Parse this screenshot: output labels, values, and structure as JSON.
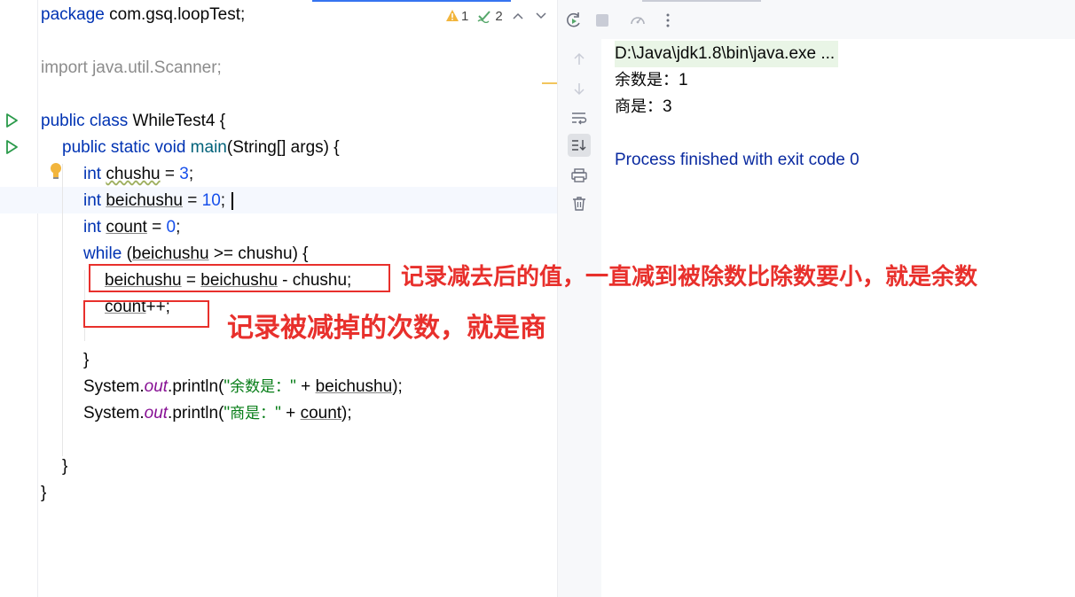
{
  "editor": {
    "package_kw": "package",
    "package_name": " com.gsq.loopTest;",
    "import_line": "import java.util.Scanner;",
    "class_decl": {
      "kw": "public class",
      "name": " WhileTest4 {"
    },
    "main_decl": {
      "kw1": "public static void",
      "fn": " main",
      "rest": "(String[] args) {"
    },
    "line_chushu": {
      "kw": "int",
      "var": "chushu",
      "eq": " = ",
      "val": "3",
      "end": ";"
    },
    "line_beichushu": {
      "kw": "int",
      "var": "beichushu",
      "eq": " = ",
      "val": "10",
      "end": ";"
    },
    "line_count": {
      "kw": "int",
      "var": "count",
      "eq": " = ",
      "val": "0",
      "end": ";"
    },
    "line_while": {
      "kw": "while",
      "open": " (",
      "var": "beichushu",
      "rest": " >= chushu) {"
    },
    "line_assign": {
      "var1": "beichushu",
      "mid": " = ",
      "var2": "beichushu",
      "rest": " - chushu;"
    },
    "line_inc": {
      "var": "count",
      "rest": "++;"
    },
    "close_while": "}",
    "println1": {
      "pre": "System.",
      "field": "out",
      "call": ".println(",
      "str_q": "\"",
      "str_text": "余数是：",
      "str_end": "\"",
      "plus": " + ",
      "var": "beichushu",
      "end": ");"
    },
    "println2": {
      "pre": "System.",
      "field": "out",
      "call": ".println(",
      "str_q": "\"",
      "str_text": "商是：",
      "str_end": "\"",
      "plus": " + ",
      "var": "count",
      "end": ");"
    },
    "close_method": "}",
    "close_class": "}"
  },
  "inspections": {
    "warnings": "1",
    "weak_warnings": "2"
  },
  "annotations": {
    "remainder_note": "记录减去后的值，一直减到被除数比除数要小，就是余数",
    "quotient_note": "记录被减掉的次数，就是商"
  },
  "console": {
    "command": "D:\\Java\\jdk1.8\\bin\\java.exe ...",
    "out1_label": "余数是：",
    "out1_value": "1",
    "out2_label": "商是：",
    "out2_value": "3",
    "finish": "Process finished with exit code 0"
  },
  "colors": {
    "keyword": "#0033b3",
    "number": "#1750eb",
    "string": "#067d17",
    "field": "#871094",
    "annotation_red": "#e8302c",
    "console_finish": "#0a2aa0"
  },
  "icons": [
    "run-gutter-icon",
    "bulb-icon",
    "warning-icon",
    "weak-warning-icon",
    "chevron-up-icon",
    "chevron-down-icon",
    "rerun-icon",
    "stop-icon",
    "profiler-icon",
    "more-icon",
    "arrow-up-icon",
    "arrow-down-icon",
    "soft-wrap-icon",
    "scroll-to-end-icon",
    "print-icon",
    "trash-icon"
  ]
}
